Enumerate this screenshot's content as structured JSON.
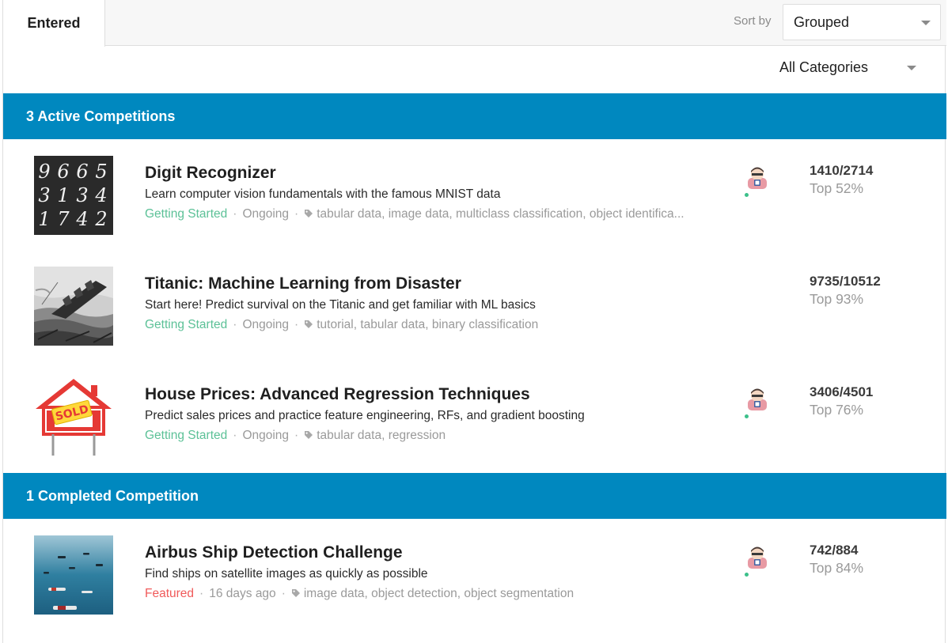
{
  "tabs": {
    "entered": "Entered"
  },
  "sort": {
    "label": "Sort by",
    "value": "Grouped"
  },
  "category_filter": {
    "value": "All Categories"
  },
  "sections": {
    "active": "3 Active Competitions",
    "completed": "1 Completed Competition"
  },
  "competitions": [
    {
      "title": "Digit Recognizer",
      "description": "Learn computer vision fundamentals with the famous MNIST data",
      "category": "Getting Started",
      "status": "Ongoing",
      "tags": "tabular data, image data, multiclass classification, object identifica...",
      "rank": "1410/2714",
      "percentile": "Top 52%",
      "digits": [
        "9",
        "6",
        "6",
        "5",
        "3",
        "1",
        "3",
        "4",
        "1",
        "7",
        "4",
        "2"
      ]
    },
    {
      "title": "Titanic: Machine Learning from Disaster",
      "description": "Start here! Predict survival on the Titanic and get familiar with ML basics",
      "category": "Getting Started",
      "status": "Ongoing",
      "tags": "tutorial, tabular data, binary classification",
      "rank": "9735/10512",
      "percentile": "Top 93%"
    },
    {
      "title": "House Prices: Advanced Regression Techniques",
      "description": "Predict sales prices and practice feature engineering, RFs, and gradient boosting",
      "category": "Getting Started",
      "status": "Ongoing",
      "tags": "tabular data, regression",
      "rank": "3406/4501",
      "percentile": "Top 76%",
      "sign_text": "SOLD"
    },
    {
      "title": "Airbus Ship Detection Challenge",
      "description": "Find ships on satellite images as quickly as possible",
      "category": "Featured",
      "status": "16 days ago",
      "tags": "image data, object detection, object segmentation",
      "rank": "742/884",
      "percentile": "Top 84%"
    }
  ],
  "colors": {
    "section_header": "#0088bf",
    "getting_started": "#5cc197",
    "featured": "#f05a5a"
  },
  "icons": [
    "tag-icon",
    "chevron-down-icon",
    "avatar"
  ]
}
